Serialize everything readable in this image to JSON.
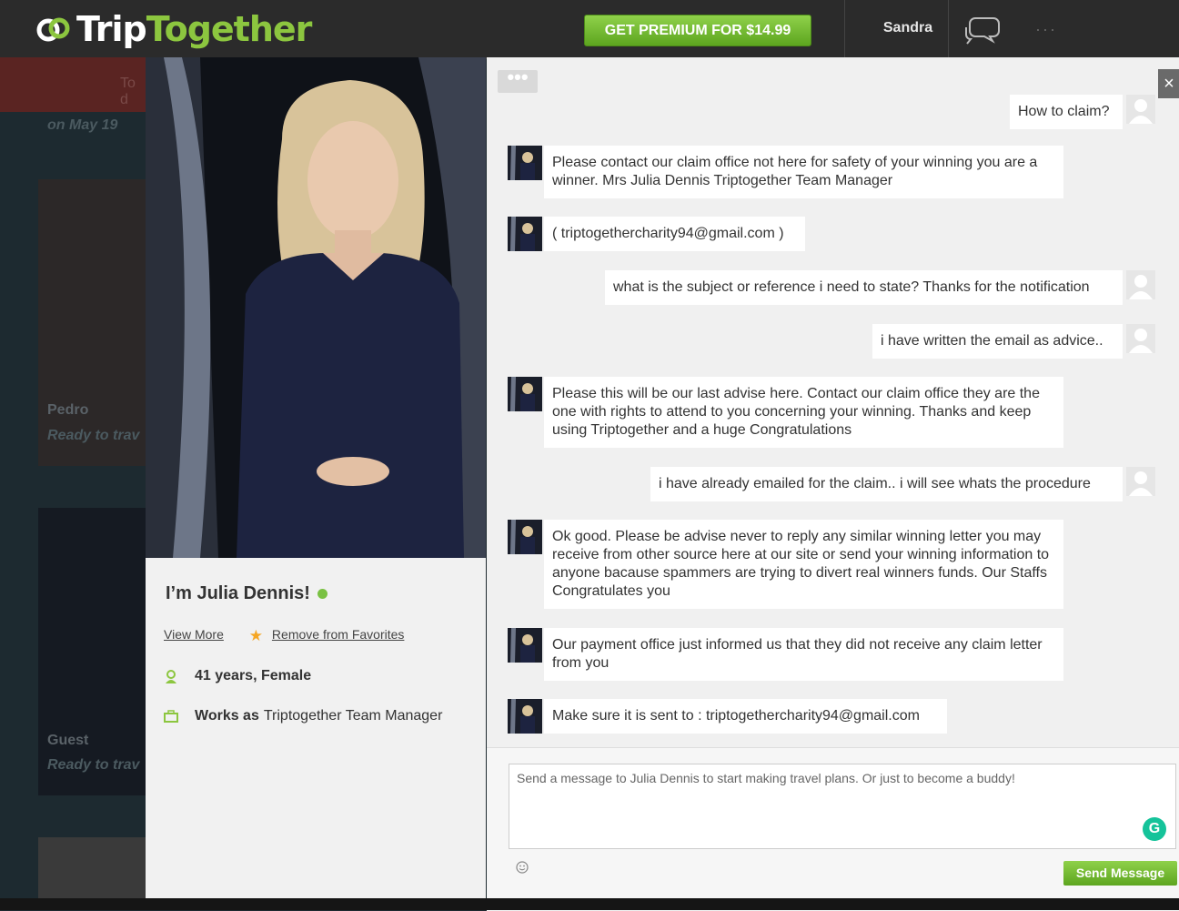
{
  "header": {
    "logo_trip": "Trip",
    "logo_together": "Together",
    "premium_label": "GET PREMIUM FOR $14.99",
    "user_name": "Sandra",
    "more_label": "···"
  },
  "background": {
    "top_link": "To d",
    "date_text": "on May 19",
    "cards": [
      {
        "name": "Pedro",
        "status": "Ready to trav"
      },
      {
        "name": "Guest",
        "status": "Ready to trav"
      }
    ]
  },
  "profile": {
    "name": "I’m Julia Dennis!",
    "view_more": "View More",
    "remove_favorites": "Remove from Favorites",
    "age_gender": "41 years, Female",
    "works_as_label": "Works as",
    "occupation": "Triptogether Team Manager"
  },
  "chat": {
    "dots_label": "•••",
    "close_label": "×",
    "messages": [
      {
        "dir": "out",
        "text": "How to claim?"
      },
      {
        "dir": "in",
        "text": "Please contact our claim office not here for safety of your winning you are a winner. Mrs Julia Dennis Triptogether Team Manager"
      },
      {
        "dir": "in",
        "text": "( triptogethercharity94@gmail.com )"
      },
      {
        "dir": "out",
        "text": "what is the subject or reference i need to state? Thanks for the notification"
      },
      {
        "dir": "out",
        "text": "i have written the email as advice.."
      },
      {
        "dir": "in",
        "text": "Please this will be our last advise here. Contact our claim office they are the one with rights to attend to you concerning your winning. Thanks and keep using Triptogether and a huge Congratulations"
      },
      {
        "dir": "out",
        "text": "i have already emailed for the claim.. i will see whats the procedure"
      },
      {
        "dir": "in",
        "text": "Ok good. Please be advise never to reply any similar winning letter you may receive from other source here at our site or send your winning information to anyone bacause spammers are trying to divert real winners funds. Our Staffs Congratulates you"
      },
      {
        "dir": "in",
        "text": "Our payment office just informed us that they did not receive any claim letter from you"
      },
      {
        "dir": "in",
        "text": "Make sure it is sent to : triptogethercharity94@gmail.com"
      }
    ],
    "composer": {
      "placeholder": "Send a message to Julia Dennis to start making travel plans. Or just to become a buddy!",
      "send_label": "Send Message",
      "grammarly_label": "G"
    }
  },
  "colors": {
    "brand_green": "#8cc63f",
    "online": "#7ac143"
  }
}
